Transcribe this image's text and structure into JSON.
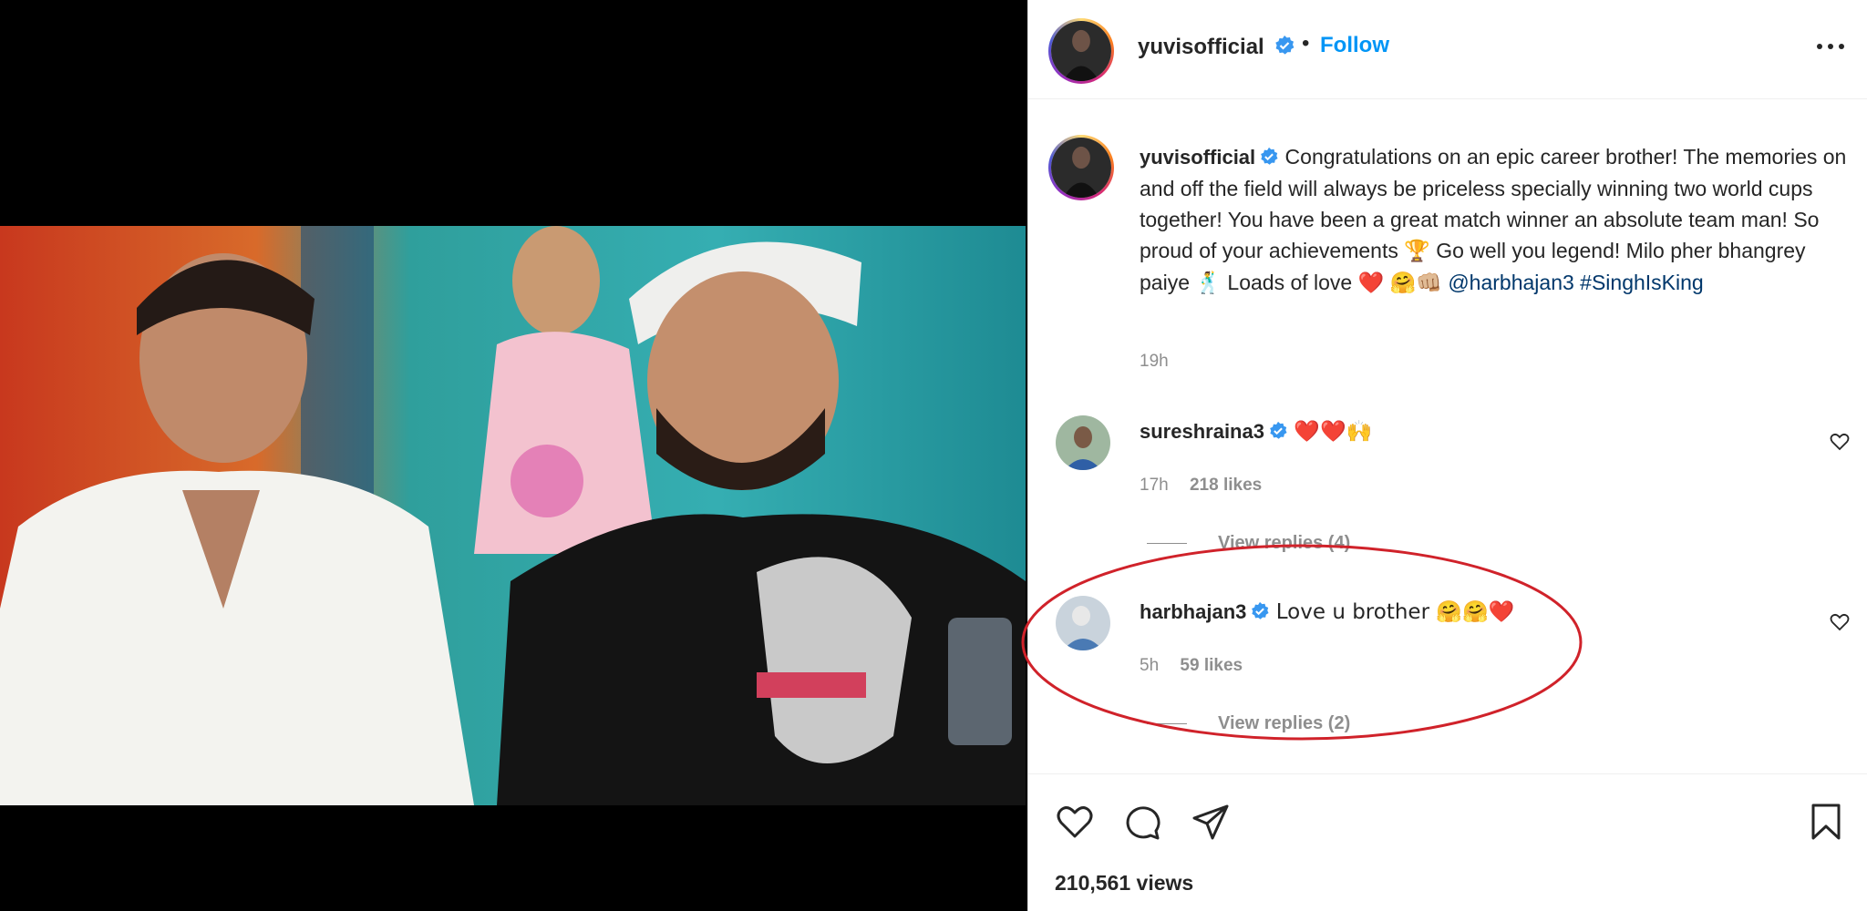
{
  "post": {
    "username": "yuvisofficial",
    "follow_label": "Follow",
    "header_dot": "•"
  },
  "caption": {
    "username": "yuvisofficial",
    "text_parts": {
      "line_a": "Congratulations on an epic career brother! The memories on and off the field will always be priceless specially winning two world cups together! You have been a great match winner an absolute team man! So proud of your achievements ",
      "emoji_trophy": "🏆",
      "line_b": " Go well you legend! Milo pher bhangrey paiye ",
      "emoji_dancer": "🕺",
      "line_c": " Loads of love ",
      "emoji_heart": "❤️",
      "emoji_hug_fist": "🤗👊🏼",
      "mention": "@harbhajan3",
      "hashtag": "#SinghIsKing"
    },
    "time": "19h"
  },
  "comments": [
    {
      "username": "sureshraina3",
      "text": "❤️❤️🙌",
      "time": "17h",
      "likes": "218 likes",
      "view_replies": "View replies (4)"
    },
    {
      "username": "harbhajan3",
      "text": "Love u brother 🤗🤗❤️",
      "time": "5h",
      "likes": "59 likes",
      "view_replies": "View replies (2)"
    }
  ],
  "footer": {
    "views": "210,561 views"
  },
  "colors": {
    "accent": "#0095f6",
    "verified": "#3897f0",
    "highlight": "#d0222a",
    "secondary_text": "#8e8e8e",
    "mention": "#00376b"
  },
  "icons": {
    "like": "heart-icon",
    "comment": "comment-icon",
    "share": "share-icon",
    "save": "bookmark-icon",
    "more": "more-options-icon",
    "verified": "verified-badge-icon"
  }
}
